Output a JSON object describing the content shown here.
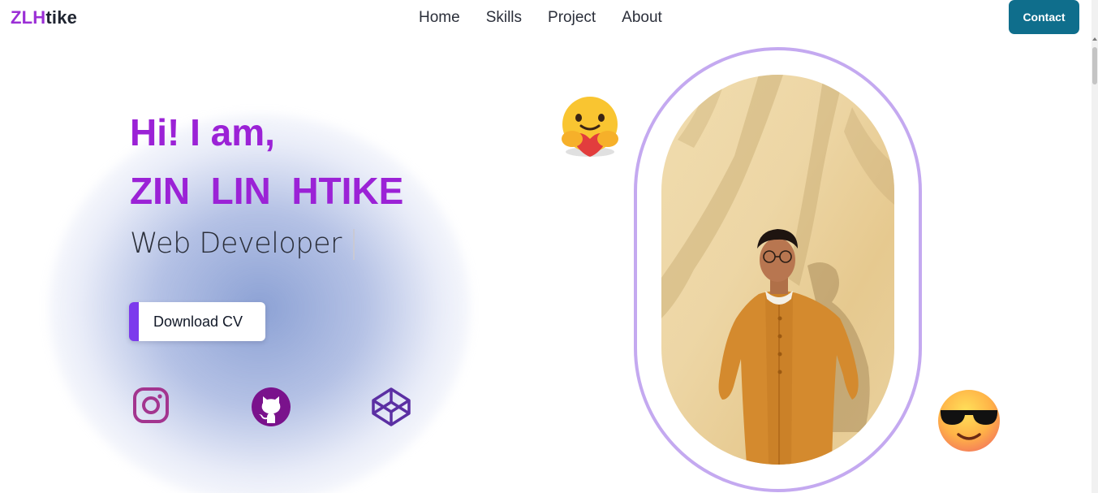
{
  "logo": {
    "part1": "ZLH",
    "part2": "tike"
  },
  "nav": {
    "links": [
      "Home",
      "Skills",
      "Project",
      "About"
    ],
    "contact_label": "Contact"
  },
  "hero": {
    "greeting": "Hi! I am,",
    "name": "ZIN  LIN  HTIKE",
    "role": "Web Developer",
    "cv_label": "Download CV"
  },
  "social": [
    "instagram-icon",
    "github-icon",
    "codepen-icon"
  ],
  "emojis": [
    "hugging-face-icon",
    "sunglasses-face-icon"
  ],
  "colors": {
    "accent_purple": "#9b22d6",
    "contact_bg": "#0f6e8c",
    "frame": "#c4a9f0",
    "cv_bar": "#7c3aed"
  }
}
